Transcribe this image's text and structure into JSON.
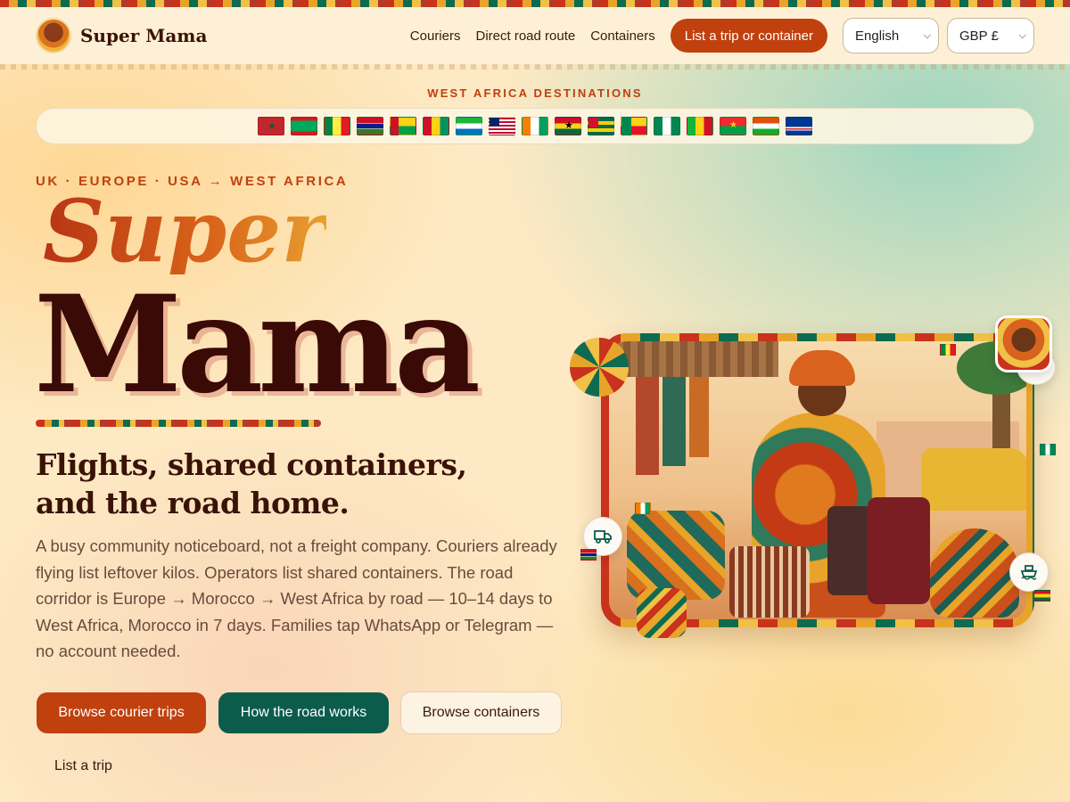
{
  "brand": {
    "name": "Super Mama"
  },
  "nav": {
    "links": [
      "Couriers",
      "Direct road route",
      "Containers"
    ],
    "cta": "List a trip or container",
    "language": "English",
    "currency": "GBP £"
  },
  "destinations": {
    "label": "WEST AFRICA DESTINATIONS",
    "flags": [
      "morocco",
      "mauritania",
      "senegal",
      "gambia",
      "guinea-bissau",
      "guinea",
      "sierra-leone",
      "liberia",
      "cote-divoire",
      "ghana",
      "togo",
      "benin",
      "nigeria",
      "mali",
      "burkina-faso",
      "niger",
      "cape-verde"
    ]
  },
  "hero": {
    "kicker": "UK · EUROPE · USA → WEST AFRICA",
    "title_line1": "Super",
    "title_line2": "Mama",
    "subhead": "Flights, shared containers, and the road home.",
    "body": "A busy community noticeboard, not a freight company. Couriers already flying list leftover kilos. Operators list shared containers. The road corridor is Europe → Morocco → West Africa by road — 10–14 days to West Africa, Morocco in 7 days. Families tap WhatsApp or Telegram — no account needed.",
    "buttons": {
      "primary": "Browse courier trips",
      "secondary": "How the road works",
      "outline": "Browse containers",
      "plain": "List a trip"
    }
  },
  "colors": {
    "accent": "#c0400e",
    "teal": "#0c5c4c",
    "ink": "#3a1208"
  }
}
